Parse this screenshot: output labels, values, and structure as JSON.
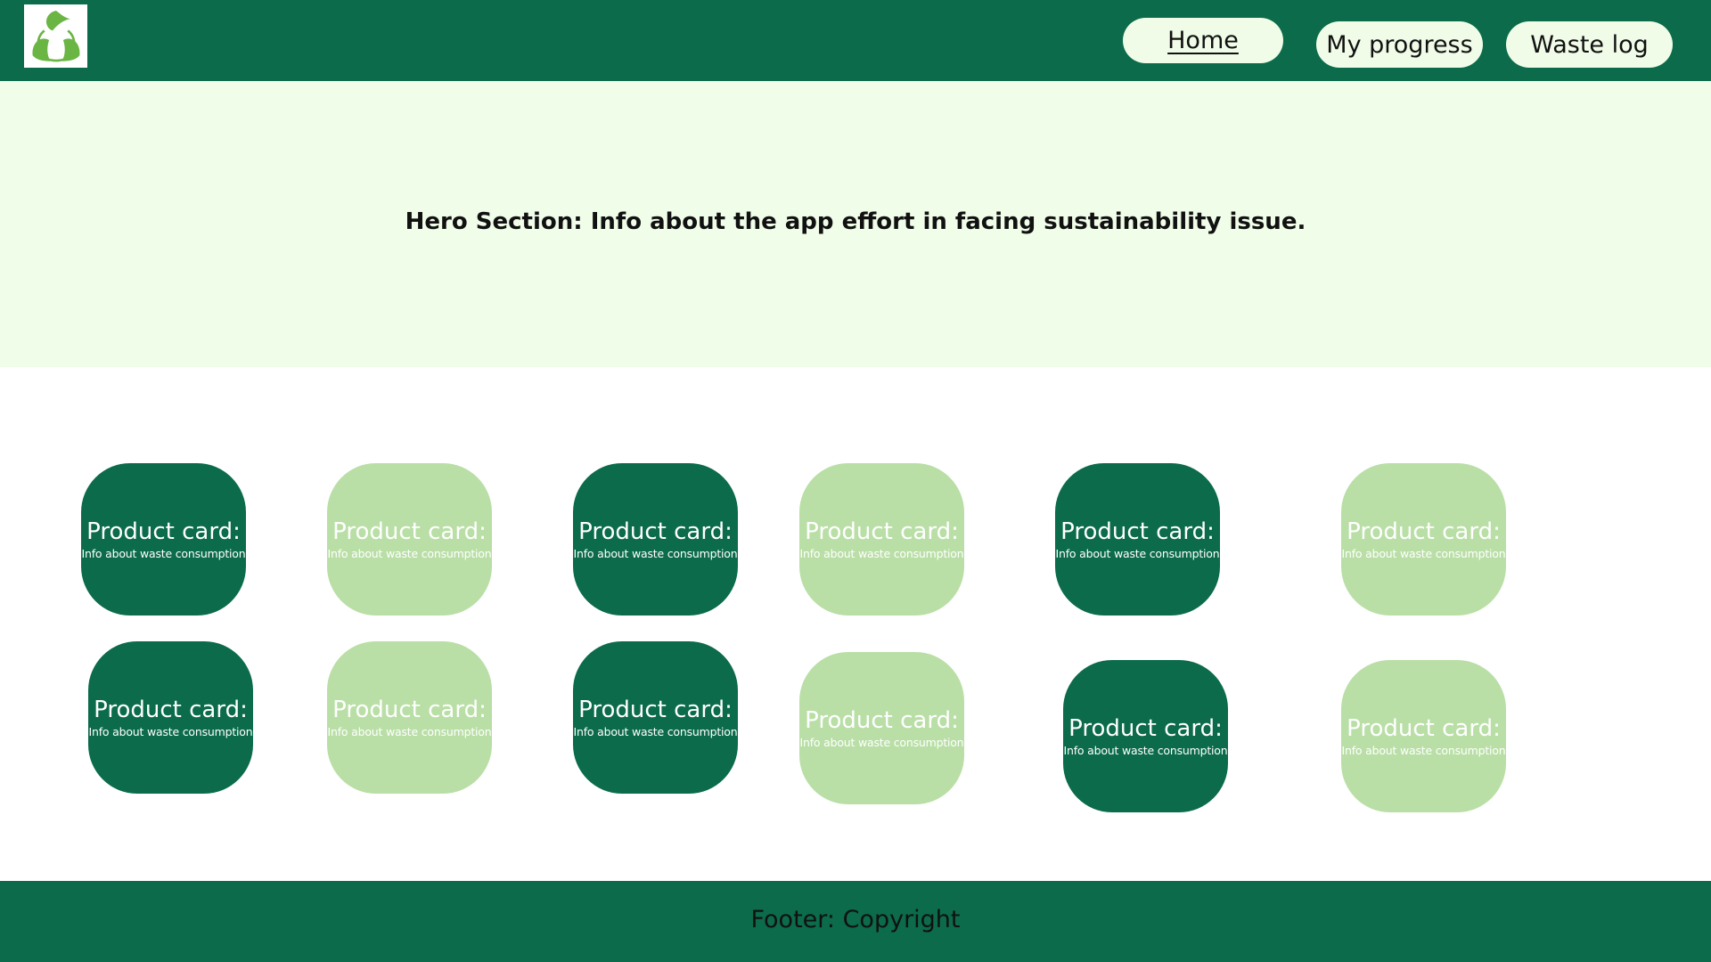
{
  "header": {
    "logo_icon": "recycle-leaves-icon",
    "nav": {
      "home": "Home",
      "progress": "My progress",
      "waste_log": "Waste log"
    }
  },
  "hero": {
    "text": "Hero Section: Info about the app effort in facing sustainability issue."
  },
  "cards": [
    {
      "title": "Product card:",
      "subtitle": "Info about waste consumption",
      "tone": "dark"
    },
    {
      "title": "Product card:",
      "subtitle": "Info about waste consumption",
      "tone": "light"
    },
    {
      "title": "Product card:",
      "subtitle": "Info about waste consumption",
      "tone": "dark"
    },
    {
      "title": "Product card:",
      "subtitle": "Info about waste consumption",
      "tone": "light"
    },
    {
      "title": "Product card:",
      "subtitle": "Info about waste consumption",
      "tone": "dark"
    },
    {
      "title": "Product card:",
      "subtitle": "Info about waste consumption",
      "tone": "light"
    },
    {
      "title": "Product card:",
      "subtitle": "Info about waste consumption",
      "tone": "dark"
    },
    {
      "title": "Product card:",
      "subtitle": "Info about waste consumption",
      "tone": "light"
    },
    {
      "title": "Product card:",
      "subtitle": "Info about waste consumption",
      "tone": "dark"
    },
    {
      "title": "Product card:",
      "subtitle": "Info about waste consumption",
      "tone": "light"
    },
    {
      "title": "Product card:",
      "subtitle": "Info about waste consumption",
      "tone": "dark"
    },
    {
      "title": "Product card:",
      "subtitle": "Info about waste consumption",
      "tone": "light"
    }
  ],
  "footer": {
    "text": "Footer: Copyright"
  },
  "colors": {
    "primary_dark_green": "#0b6b4a",
    "light_green_card": "#b9dfa6",
    "hero_background": "#f0fde8",
    "nav_button_background": "#f0fce8",
    "logo_leaf_green": "#6ab543"
  }
}
